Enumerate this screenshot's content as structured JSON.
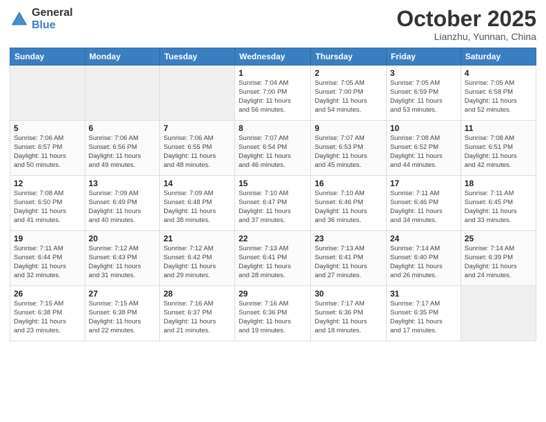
{
  "logo": {
    "general": "General",
    "blue": "Blue"
  },
  "title": "October 2025",
  "subtitle": "Lianzhu, Yunnan, China",
  "headers": [
    "Sunday",
    "Monday",
    "Tuesday",
    "Wednesday",
    "Thursday",
    "Friday",
    "Saturday"
  ],
  "weeks": [
    [
      {
        "day": "",
        "info": ""
      },
      {
        "day": "",
        "info": ""
      },
      {
        "day": "",
        "info": ""
      },
      {
        "day": "1",
        "info": "Sunrise: 7:04 AM\nSunset: 7:00 PM\nDaylight: 11 hours\nand 56 minutes."
      },
      {
        "day": "2",
        "info": "Sunrise: 7:05 AM\nSunset: 7:00 PM\nDaylight: 11 hours\nand 54 minutes."
      },
      {
        "day": "3",
        "info": "Sunrise: 7:05 AM\nSunset: 6:59 PM\nDaylight: 11 hours\nand 53 minutes."
      },
      {
        "day": "4",
        "info": "Sunrise: 7:05 AM\nSunset: 6:58 PM\nDaylight: 11 hours\nand 52 minutes."
      }
    ],
    [
      {
        "day": "5",
        "info": "Sunrise: 7:06 AM\nSunset: 6:57 PM\nDaylight: 11 hours\nand 50 minutes."
      },
      {
        "day": "6",
        "info": "Sunrise: 7:06 AM\nSunset: 6:56 PM\nDaylight: 11 hours\nand 49 minutes."
      },
      {
        "day": "7",
        "info": "Sunrise: 7:06 AM\nSunset: 6:55 PM\nDaylight: 11 hours\nand 48 minutes."
      },
      {
        "day": "8",
        "info": "Sunrise: 7:07 AM\nSunset: 6:54 PM\nDaylight: 11 hours\nand 46 minutes."
      },
      {
        "day": "9",
        "info": "Sunrise: 7:07 AM\nSunset: 6:53 PM\nDaylight: 11 hours\nand 45 minutes."
      },
      {
        "day": "10",
        "info": "Sunrise: 7:08 AM\nSunset: 6:52 PM\nDaylight: 11 hours\nand 44 minutes."
      },
      {
        "day": "11",
        "info": "Sunrise: 7:08 AM\nSunset: 6:51 PM\nDaylight: 11 hours\nand 42 minutes."
      }
    ],
    [
      {
        "day": "12",
        "info": "Sunrise: 7:08 AM\nSunset: 6:50 PM\nDaylight: 11 hours\nand 41 minutes."
      },
      {
        "day": "13",
        "info": "Sunrise: 7:09 AM\nSunset: 6:49 PM\nDaylight: 11 hours\nand 40 minutes."
      },
      {
        "day": "14",
        "info": "Sunrise: 7:09 AM\nSunset: 6:48 PM\nDaylight: 11 hours\nand 38 minutes."
      },
      {
        "day": "15",
        "info": "Sunrise: 7:10 AM\nSunset: 6:47 PM\nDaylight: 11 hours\nand 37 minutes."
      },
      {
        "day": "16",
        "info": "Sunrise: 7:10 AM\nSunset: 6:46 PM\nDaylight: 11 hours\nand 36 minutes."
      },
      {
        "day": "17",
        "info": "Sunrise: 7:11 AM\nSunset: 6:46 PM\nDaylight: 11 hours\nand 34 minutes."
      },
      {
        "day": "18",
        "info": "Sunrise: 7:11 AM\nSunset: 6:45 PM\nDaylight: 11 hours\nand 33 minutes."
      }
    ],
    [
      {
        "day": "19",
        "info": "Sunrise: 7:11 AM\nSunset: 6:44 PM\nDaylight: 11 hours\nand 32 minutes."
      },
      {
        "day": "20",
        "info": "Sunrise: 7:12 AM\nSunset: 6:43 PM\nDaylight: 11 hours\nand 31 minutes."
      },
      {
        "day": "21",
        "info": "Sunrise: 7:12 AM\nSunset: 6:42 PM\nDaylight: 11 hours\nand 29 minutes."
      },
      {
        "day": "22",
        "info": "Sunrise: 7:13 AM\nSunset: 6:41 PM\nDaylight: 11 hours\nand 28 minutes."
      },
      {
        "day": "23",
        "info": "Sunrise: 7:13 AM\nSunset: 6:41 PM\nDaylight: 11 hours\nand 27 minutes."
      },
      {
        "day": "24",
        "info": "Sunrise: 7:14 AM\nSunset: 6:40 PM\nDaylight: 11 hours\nand 26 minutes."
      },
      {
        "day": "25",
        "info": "Sunrise: 7:14 AM\nSunset: 6:39 PM\nDaylight: 11 hours\nand 24 minutes."
      }
    ],
    [
      {
        "day": "26",
        "info": "Sunrise: 7:15 AM\nSunset: 6:38 PM\nDaylight: 11 hours\nand 23 minutes."
      },
      {
        "day": "27",
        "info": "Sunrise: 7:15 AM\nSunset: 6:38 PM\nDaylight: 11 hours\nand 22 minutes."
      },
      {
        "day": "28",
        "info": "Sunrise: 7:16 AM\nSunset: 6:37 PM\nDaylight: 11 hours\nand 21 minutes."
      },
      {
        "day": "29",
        "info": "Sunrise: 7:16 AM\nSunset: 6:36 PM\nDaylight: 11 hours\nand 19 minutes."
      },
      {
        "day": "30",
        "info": "Sunrise: 7:17 AM\nSunset: 6:36 PM\nDaylight: 11 hours\nand 18 minutes."
      },
      {
        "day": "31",
        "info": "Sunrise: 7:17 AM\nSunset: 6:35 PM\nDaylight: 11 hours\nand 17 minutes."
      },
      {
        "day": "",
        "info": ""
      }
    ]
  ]
}
